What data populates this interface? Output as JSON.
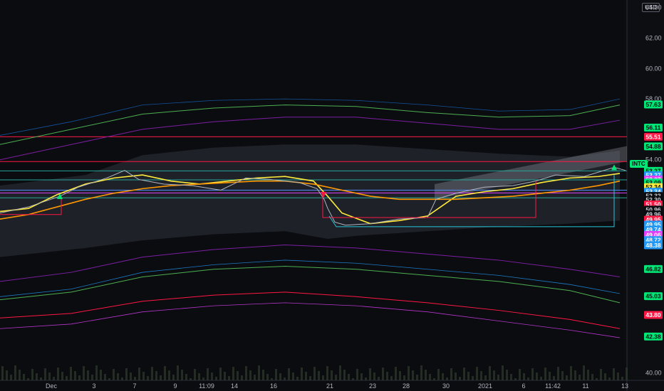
{
  "header": {
    "currency": "USD"
  },
  "ticker": {
    "symbol": "INTC"
  },
  "chart_data": {
    "type": "line",
    "ylim": [
      39.5,
      64.5
    ],
    "y_ticks": [
      "64.00",
      "62.00",
      "60.00",
      "58.00",
      "56.00",
      "54.00",
      "52.00",
      "40.00"
    ],
    "x_ticks": [
      "Dec",
      "3",
      "7",
      "9",
      "11:09",
      "14",
      "16",
      "21",
      "23",
      "28",
      "30",
      "2021",
      "6",
      "11:42",
      "11",
      "13"
    ],
    "series": [
      {
        "color": "#ffeb3b",
        "x": [
          0,
          40,
          80,
          120,
          160,
          200,
          240,
          280,
          320,
          360,
          400,
          440,
          460,
          480,
          520,
          560,
          600,
          640,
          680,
          720,
          760,
          800,
          840,
          870
        ],
        "y": [
          50.6,
          50.8,
          51.7,
          52.4,
          52.8,
          53.0,
          52.6,
          52.4,
          52.6,
          52.8,
          52.9,
          52.6,
          51.6,
          50.5,
          49.8,
          50.0,
          50.3,
          51.6,
          51.9,
          52.1,
          52.5,
          52.8,
          52.9,
          53.1
        ]
      },
      {
        "color": "#ff9800",
        "x": [
          0,
          40,
          80,
          120,
          160,
          200,
          240,
          280,
          320,
          360,
          400,
          440,
          480,
          520,
          560,
          600,
          640,
          680,
          720,
          760,
          800,
          840,
          870
        ],
        "y": [
          50.1,
          50.4,
          50.9,
          51.4,
          51.8,
          52.1,
          52.3,
          52.4,
          52.5,
          52.6,
          52.6,
          52.4,
          52.0,
          51.6,
          51.4,
          51.4,
          51.4,
          51.5,
          51.6,
          51.8,
          52.0,
          52.3,
          52.6
        ]
      },
      {
        "color": "#4caf50",
        "x": [
          0,
          100,
          200,
          300,
          400,
          500,
          600,
          700,
          800,
          870
        ],
        "y": [
          55.0,
          56.0,
          57.0,
          57.4,
          57.6,
          57.5,
          57.1,
          56.8,
          56.9,
          57.6
        ]
      },
      {
        "color": "#7b1fa2",
        "x": [
          0,
          100,
          200,
          300,
          400,
          500,
          600,
          700,
          800,
          870
        ],
        "y": [
          54.0,
          55.0,
          56.0,
          56.5,
          56.8,
          56.8,
          56.4,
          56.0,
          56.0,
          56.6
        ]
      },
      {
        "color": "#7b1fa2",
        "x": [
          0,
          100,
          200,
          300,
          400,
          500,
          600,
          700,
          800,
          870
        ],
        "y": [
          46.0,
          46.6,
          47.6,
          48.1,
          48.4,
          48.2,
          47.8,
          47.4,
          46.8,
          46.3
        ]
      },
      {
        "color": "#4caf50",
        "x": [
          0,
          100,
          200,
          300,
          400,
          500,
          600,
          700,
          800,
          870
        ],
        "y": [
          44.8,
          45.3,
          46.3,
          46.8,
          47.0,
          46.8,
          46.4,
          46.0,
          45.4,
          44.6
        ]
      },
      {
        "color": "#ff1744",
        "x": [
          0,
          100,
          200,
          300,
          400,
          500,
          600,
          700,
          800,
          870
        ],
        "y": [
          43.6,
          43.9,
          44.7,
          45.1,
          45.3,
          45.0,
          44.6,
          44.1,
          43.5,
          42.9
        ]
      }
    ],
    "levels": [
      {
        "value": 55.51,
        "color": "#ff1744"
      },
      {
        "value": 53.88,
        "color": "#ff1744"
      },
      {
        "value": 53.27,
        "color": "#26a69a"
      },
      {
        "value": 52.68,
        "color": "#26a69a"
      },
      {
        "value": 52.0,
        "color": "#4f8cff"
      },
      {
        "value": 51.82,
        "color": "#e040fb"
      },
      {
        "value": 51.5,
        "color": "#26a69a"
      }
    ],
    "price_labels": [
      {
        "text": "57.63",
        "value": 57.63,
        "bg": "#00e676",
        "fg": "#0b0c10"
      },
      {
        "text": "56.11",
        "value": 56.11,
        "bg": "#00e676",
        "fg": "#0b0c10"
      },
      {
        "text": "55.51",
        "value": 55.51,
        "bg": "#ff1744",
        "fg": "#ffffff"
      },
      {
        "text": "54.88",
        "value": 54.88,
        "bg": "#00e676",
        "fg": "#0b0c10"
      },
      {
        "text": "53.27",
        "value": 53.27,
        "bg": "#00e676",
        "fg": "#0b0c10"
      },
      {
        "text": "53.27",
        "value": 52.98,
        "bg": "#2196f3",
        "fg": "#ffffff"
      },
      {
        "text": "53.27",
        "value": 52.7,
        "bg": "#e040fb",
        "fg": "#ffffff"
      },
      {
        "text": "53.09",
        "value": 52.5,
        "bg": "#00e676",
        "fg": "#0b0c10"
      },
      {
        "text": "52.34",
        "value": 52.2,
        "bg": "#ffeb3b",
        "fg": "#0b0c10"
      },
      {
        "text": "52.34",
        "value": 51.9,
        "bg": "#2196f3",
        "fg": "#ffffff"
      },
      {
        "text": "52.32",
        "value": 51.62,
        "bg": "#0b0c10",
        "fg": "#d1d4dc"
      },
      {
        "text": "52.30",
        "value": 51.36,
        "bg": "#0b0c10",
        "fg": "#d1d4dc"
      },
      {
        "text": "51.50",
        "value": 51.06,
        "bg": "#ff1744",
        "fg": "#ffffff"
      },
      {
        "text": "50.96",
        "value": 50.72,
        "bg": "#0b0c10",
        "fg": "#d1d4dc"
      },
      {
        "text": "49.96",
        "value": 50.4,
        "bg": "#0b0c10",
        "fg": "#d1d4dc"
      },
      {
        "text": "49.95",
        "value": 50.06,
        "bg": "#ff1744",
        "fg": "#ffffff"
      },
      {
        "text": "49.95",
        "value": 49.74,
        "bg": "#2196f3",
        "fg": "#ffffff"
      },
      {
        "text": "49.74",
        "value": 49.4,
        "bg": "#2196f3",
        "fg": "#ffffff"
      },
      {
        "text": "49.06",
        "value": 49.06,
        "bg": "#e040fb",
        "fg": "#ffffff"
      },
      {
        "text": "48.72",
        "value": 48.72,
        "bg": "#2196f3",
        "fg": "#ffffff"
      },
      {
        "text": "48.38",
        "value": 48.38,
        "bg": "#2196f3",
        "fg": "#ffffff"
      },
      {
        "text": "46.82",
        "value": 46.82,
        "bg": "#00e676",
        "fg": "#0b0c10"
      },
      {
        "text": "45.03",
        "value": 45.03,
        "bg": "#00e676",
        "fg": "#0b0c10"
      },
      {
        "text": "43.80",
        "value": 43.8,
        "bg": "#ff1744",
        "fg": "#ffffff"
      },
      {
        "text": "42.38",
        "value": 42.38,
        "bg": "#00e676",
        "fg": "#0b0c10"
      }
    ]
  }
}
